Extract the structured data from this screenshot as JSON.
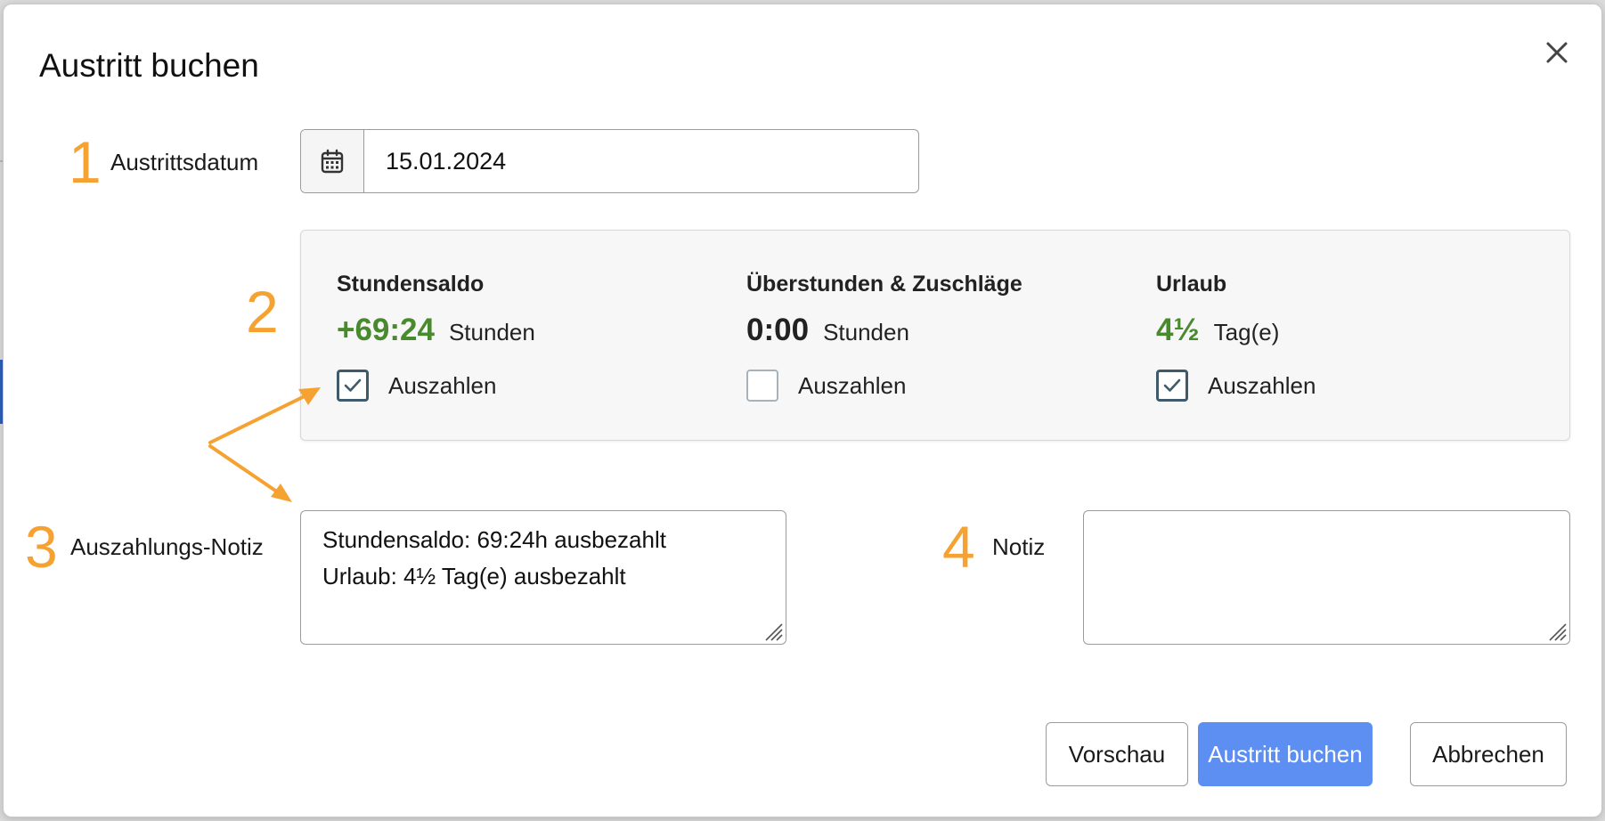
{
  "dialog": {
    "title": "Austritt buchen"
  },
  "steps": [
    "1",
    "2",
    "3",
    "4"
  ],
  "exit_date": {
    "label": "Austrittsdatum",
    "value": "15.01.2024",
    "icon": "calendar-icon"
  },
  "summary": {
    "balance": {
      "title": "Stundensaldo",
      "value": "+69:24",
      "unit": "Stunden",
      "checkbox_label": "Auszahlen",
      "checked": true
    },
    "overtime": {
      "title": "Überstunden & Zuschläge",
      "value": "0:00",
      "unit": "Stunden",
      "checkbox_label": "Auszahlen",
      "checked": false
    },
    "vacation": {
      "title": "Urlaub",
      "value": "4½",
      "unit": "Tag(e)",
      "checkbox_label": "Auszahlen",
      "checked": true
    }
  },
  "payout_note": {
    "label": "Auszahlungs-Notiz",
    "line1": "Stundensaldo: 69:24h ausbezahlt",
    "line2": "Urlaub: 4½ Tag(e) ausbezahlt"
  },
  "note": {
    "label": "Notiz",
    "value": ""
  },
  "buttons": {
    "preview": "Vorschau",
    "submit": "Austritt buchen",
    "cancel": "Abbrechen"
  },
  "colors": {
    "accent_orange": "#f5a233",
    "primary_blue": "#5d8ff2",
    "positive_green": "#4a8a2e",
    "checkbox_dark": "#3f5a6b"
  }
}
